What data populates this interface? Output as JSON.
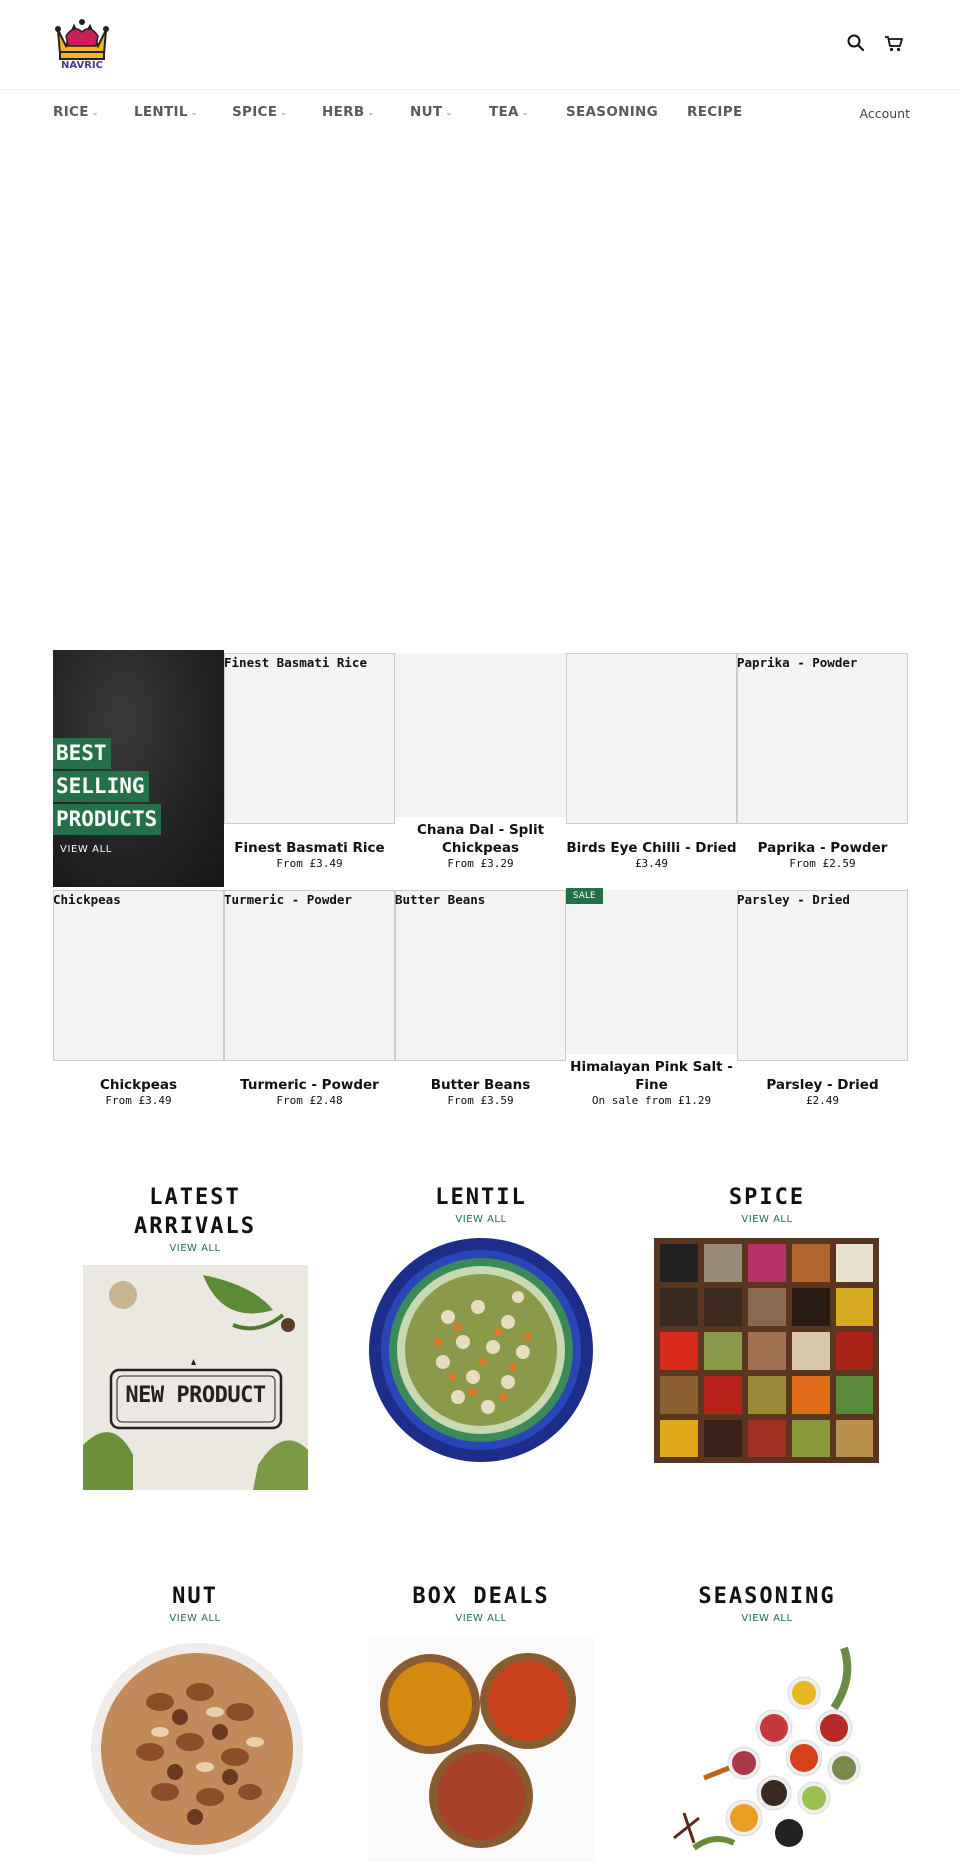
{
  "header": {
    "logo_text": "NAVRIC",
    "search_icon": "search-icon",
    "cart_icon": "cart-icon"
  },
  "nav": {
    "items": [
      {
        "label": "RICE",
        "has_dropdown": true
      },
      {
        "label": "LENTIL",
        "has_dropdown": true
      },
      {
        "label": "SPICE",
        "has_dropdown": true
      },
      {
        "label": "HERB",
        "has_dropdown": true
      },
      {
        "label": "NUT",
        "has_dropdown": true
      },
      {
        "label": "TEA",
        "has_dropdown": true
      },
      {
        "label": "SEASONING",
        "has_dropdown": false
      },
      {
        "label": "RECIPE",
        "has_dropdown": false
      }
    ],
    "dropdown_glyph": "⌄",
    "account": "Account"
  },
  "feature": {
    "lines": [
      "BEST",
      "SELLING",
      "PRODUCTS"
    ],
    "view_all": "VIEW ALL"
  },
  "products": [
    {
      "alt": "Finest Basmati Rice",
      "name": "Finest Basmati Rice",
      "price": "From £3.49"
    },
    {
      "alt": "",
      "name": "Chana Dal - Split Chickpeas",
      "price": "From £3.29"
    },
    {
      "alt": "",
      "name": "Birds Eye Chilli - Dried",
      "price": "£3.49"
    },
    {
      "alt": "Paprika - Powder",
      "name": "Paprika - Powder",
      "price": "From £2.59"
    },
    {
      "alt": "Chickpeas",
      "name": "Chickpeas",
      "price": "From £3.49"
    },
    {
      "alt": "Turmeric - Powder",
      "name": "Turmeric - Powder",
      "price": "From £2.48"
    },
    {
      "alt": "Butter Beans",
      "name": "Butter Beans",
      "price": "From £3.59"
    },
    {
      "alt": "",
      "name": "Himalayan Pink Salt - Fine",
      "price": "On sale from £1.29",
      "badge": "SALE"
    },
    {
      "alt": "Parsley - Dried",
      "name": "Parsley - Dried",
      "price": "£2.49"
    }
  ],
  "collections": [
    {
      "title": "LATEST ARRIVALS",
      "view": "VIEW ALL",
      "image_text": "NEW PRODUCT"
    },
    {
      "title": "LENTIL",
      "view": "VIEW ALL"
    },
    {
      "title": "SPICE",
      "view": "VIEW ALL"
    },
    {
      "title": "NUT",
      "view": "VIEW ALL"
    },
    {
      "title": "BOX DEALS",
      "view": "VIEW ALL"
    },
    {
      "title": "SEASONING",
      "view": "VIEW ALL"
    }
  ],
  "colors": {
    "accent": "#23704a",
    "nav_text": "#5a5a5a",
    "placeholder": "#f4f4f4"
  }
}
